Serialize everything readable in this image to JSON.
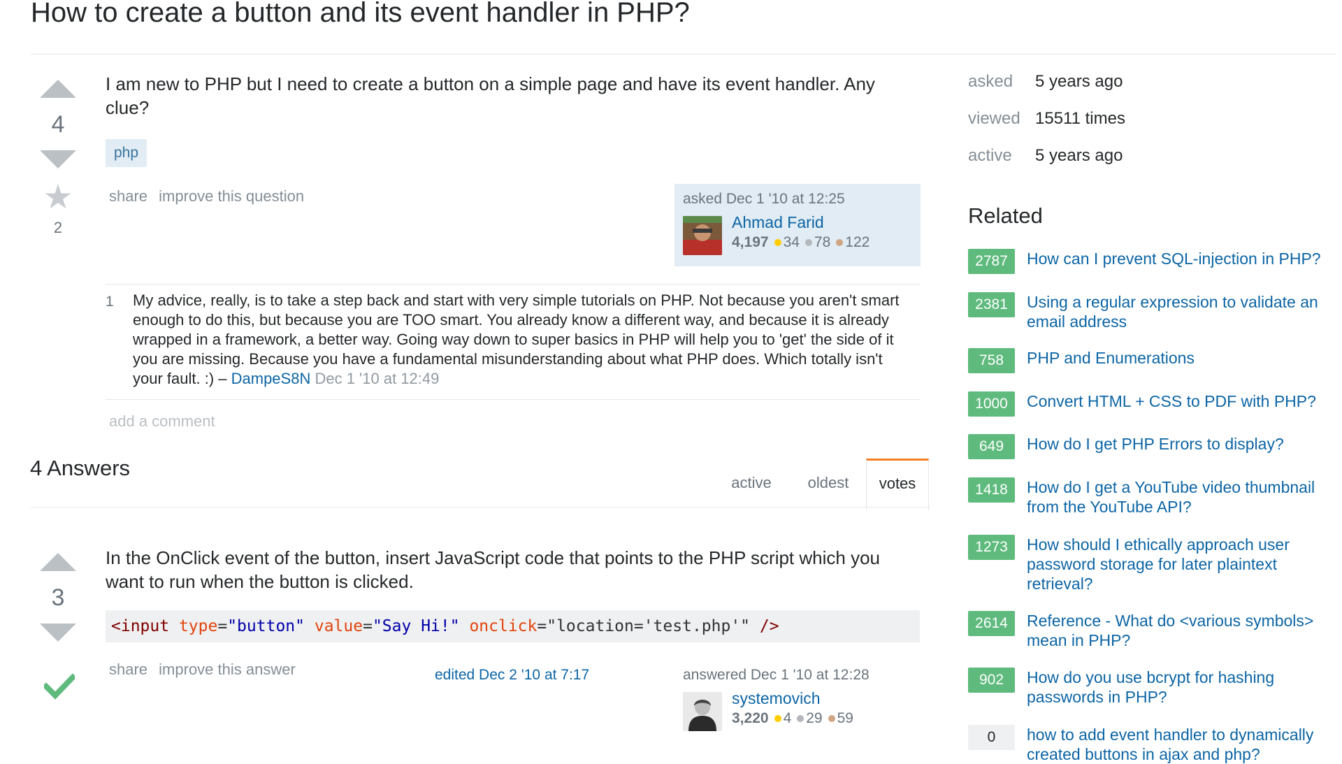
{
  "question": {
    "title": "How to create a button and its event handler in PHP?",
    "votes": "4",
    "favorites": "2",
    "body": "I am new to PHP but I need to create a button on a simple page and have its event handler. Any clue?",
    "tag": "php",
    "menu": {
      "share": "share",
      "improve": "improve this question"
    },
    "signature": {
      "action": "asked Dec 1 '10 at 12:25",
      "user": "Ahmad Farid",
      "rep": "4,197",
      "gold": "34",
      "silver": "78",
      "bronze": "122"
    },
    "comment": {
      "score": "1",
      "text": "My advice, really, is to take a step back and start with very simple tutorials on PHP. Not because you aren't smart enough to do this, but because you are TOO smart. You already know a different way, and because it is already wrapped in a framework, a better way. Going way down to super basics in PHP will help you to 'get' the side of it you are missing. Because you have a fundamental misunderstanding about what PHP does. Which totally isn't your fault. :) – ",
      "user": "DampeS8N",
      "date": "Dec 1 '10 at 12:49"
    },
    "add_comment": "add a comment"
  },
  "answers_header": {
    "count_label": "4 Answers",
    "tabs": [
      "active",
      "oldest",
      "votes"
    ],
    "active_tab": "votes"
  },
  "answer": {
    "votes": "3",
    "body": "In the OnClick event of the button, insert JavaScript code that points to the PHP script which you want to run when the button is clicked.",
    "code": {
      "open": "<input",
      "attr1": "type",
      "val1": "\"button\"",
      "attr2": "value",
      "val2": "\"Say Hi!\"",
      "attr3": "onclick",
      "val3": "\"location='test.php'\"",
      "close": "/>"
    },
    "menu": {
      "share": "share",
      "improve": "improve this answer"
    },
    "edited": "edited Dec 2 '10 at 7:17",
    "signature": {
      "action": "answered Dec 1 '10 at 12:28",
      "user": "systemovich",
      "rep": "3,220",
      "gold": "4",
      "silver": "29",
      "bronze": "59"
    }
  },
  "sidebar": {
    "meta": [
      {
        "key": "asked",
        "value": "5 years ago"
      },
      {
        "key": "viewed",
        "value": "15511 times"
      },
      {
        "key": "active",
        "value": "5 years ago"
      }
    ],
    "related_title": "Related",
    "related": [
      {
        "score": "2787",
        "title": "How can I prevent SQL-injection in PHP?"
      },
      {
        "score": "2381",
        "title": "Using a regular expression to validate an email address"
      },
      {
        "score": "758",
        "title": "PHP and Enumerations"
      },
      {
        "score": "1000",
        "title": "Convert HTML + CSS to PDF with PHP?"
      },
      {
        "score": "649",
        "title": "How do I get PHP Errors to display?"
      },
      {
        "score": "1418",
        "title": "How do I get a YouTube video thumbnail from the YouTube API?"
      },
      {
        "score": "1273",
        "title": "How should I ethically approach user password storage for later plaintext retrieval?"
      },
      {
        "score": "2614",
        "title": "Reference - What do <various symbols> mean in PHP?"
      },
      {
        "score": "902",
        "title": "How do you use bcrypt for hashing passwords in PHP?"
      },
      {
        "score": "0",
        "title": "how to add event handler to dynamically created buttons in ajax and php?"
      }
    ]
  },
  "colors": {
    "accent": "#f48024",
    "link": "#0c65a5",
    "answered_score": "#5eba7d",
    "tag_bg": "#e1ecf4",
    "accepted": "#5eba7d"
  }
}
